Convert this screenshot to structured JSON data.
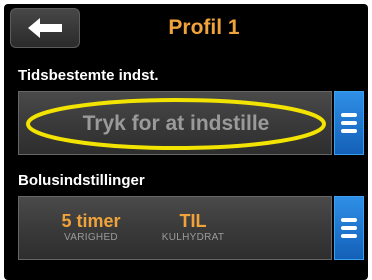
{
  "header": {
    "title": "Profil 1",
    "back_icon": "arrow-left-icon"
  },
  "timed_settings": {
    "label": "Tidsbestemte indst.",
    "placeholder": "Tryk for at indstille",
    "menu_icon": "hamburger-menu-icon",
    "highlight_color": "#f2e400"
  },
  "bolus_settings": {
    "label": "Bolusindstillinger",
    "duration_value": "5 timer",
    "duration_label": "VARIGHED",
    "carb_value": "TIL",
    "carb_label": "KULHYDRAT",
    "menu_icon": "hamburger-menu-icon"
  },
  "colors": {
    "accent": "#f0a33a",
    "background": "#000000",
    "menu_button": "#1e78d6",
    "muted_text": "#9a9a9a"
  }
}
